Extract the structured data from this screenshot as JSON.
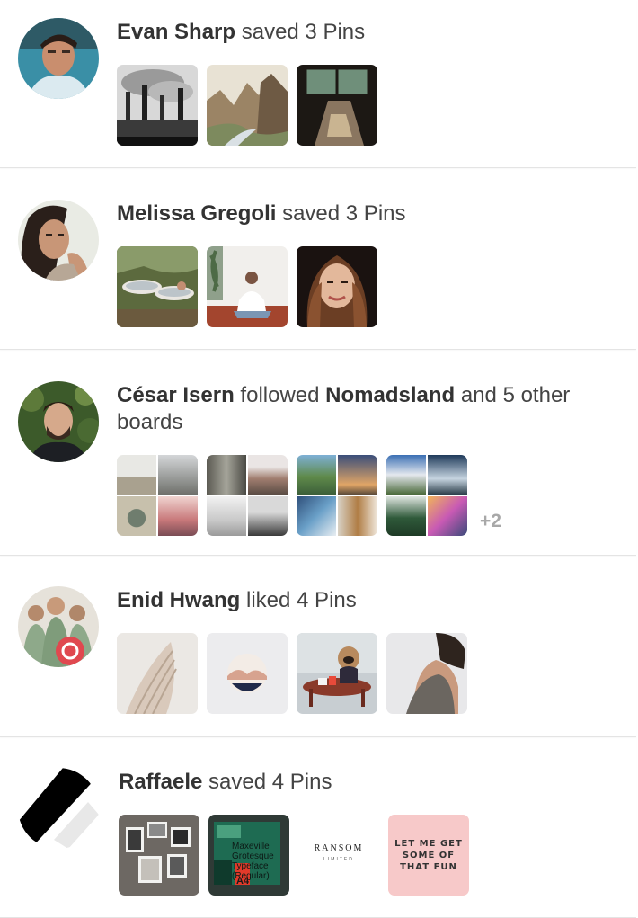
{
  "activities": [
    {
      "actor": "Evan Sharp",
      "action": "saved 3 Pins",
      "pins": [
        "industrial-smokestacks-photo",
        "canyon-river-photo",
        "sunlit-room-photo"
      ]
    },
    {
      "actor": "Melissa Gregoli",
      "action": "saved 3 Pins",
      "pins": [
        "garden-bathtubs-photo",
        "woman-sitting-rug-photo",
        "woman-portrait-photo"
      ]
    },
    {
      "actor": "César Isern",
      "action_pre": "followed",
      "board": "Nomadsland",
      "action_post": "and 5 other boards",
      "extra_count": "+2"
    },
    {
      "actor": "Enid Hwang",
      "action": "liked 4 Pins",
      "pins": [
        "draped-fabric-photo",
        "round-print-photo",
        "dog-figurine-tea-photo",
        "model-shoulder-photo"
      ]
    },
    {
      "actor": "Raffaele",
      "action": "saved 4 Pins",
      "pins": [
        "photo-frames-wall",
        "typeface-poster",
        "ransom-logo",
        "lettering-print"
      ],
      "typeface_poster_text": "Maxeville Grotesque Typeface (Regular)",
      "typeface_poster_label": "A4",
      "ransom_logo_text": "RANSOM",
      "ransom_logo_sub": "LIMITED",
      "lettering_text": "LET ME GET SOME OF THAT FUN"
    }
  ],
  "colors": {
    "text_bold": "#333333",
    "text_regular": "#444444",
    "more_count": "#a8a8a8",
    "divider": "#e4e4e4"
  }
}
